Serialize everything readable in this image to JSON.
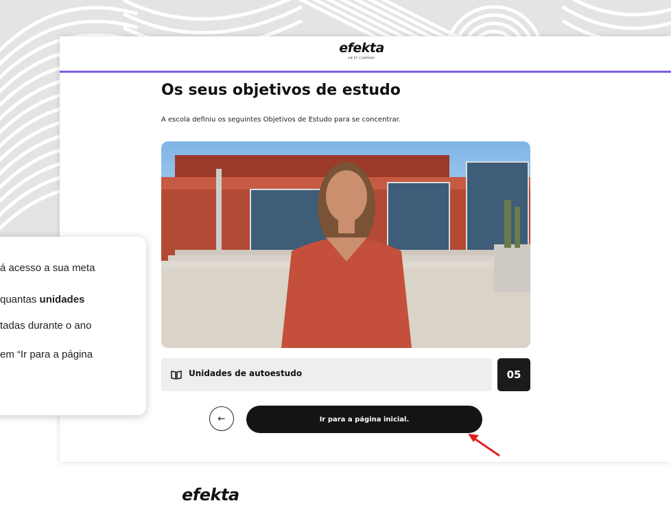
{
  "header": {
    "brand_name": "efekta",
    "brand_subtitle": "AN EF COMPANY"
  },
  "main": {
    "title": "Os seus objetivos de estudo",
    "subtitle": "A escola definiu os seguintes Objetivos de Estudo para se concentrar.",
    "stat": {
      "label": "Unidades de autoestudo",
      "value": "05",
      "icon": "book-icon"
    },
    "back_icon": "←",
    "primary_button_label": "Ir para a página inicial."
  },
  "callout": {
    "line1": "á acesso a sua meta",
    "line2_pre": " quantas ",
    "line2_bold": "unidades",
    "line3": "tadas durante o ano",
    "line4": "em “Ir para a página"
  },
  "footer": {
    "brand_name": "efekta"
  },
  "colors": {
    "accent": "#7d5ce6",
    "button": "#141414",
    "arrow": "#e02020"
  }
}
